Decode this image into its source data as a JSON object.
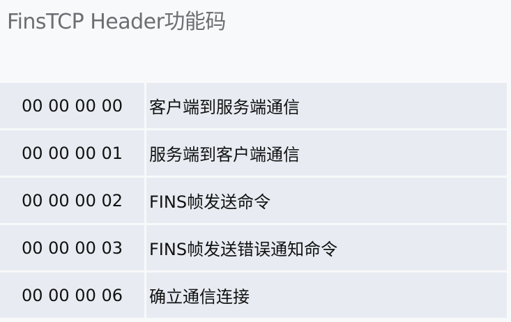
{
  "title": "FinsTCP Header功能码",
  "rows": [
    {
      "code": "00 00 00 00",
      "description": "客户端到服务端通信"
    },
    {
      "code": "00 00 00 01",
      "description": "服务端到客户端通信"
    },
    {
      "code": "00 00 00 02",
      "description": "FINS帧发送命令"
    },
    {
      "code": "00 00 00 03",
      "description": "FINS帧发送错误通知命令"
    },
    {
      "code": "00 00 00 06",
      "description": "确立通信连接"
    }
  ],
  "colors": {
    "background": "#f8f9fa",
    "cell": "#e8ecf2",
    "title_text": "#6b6f73",
    "cell_text": "#111111"
  }
}
